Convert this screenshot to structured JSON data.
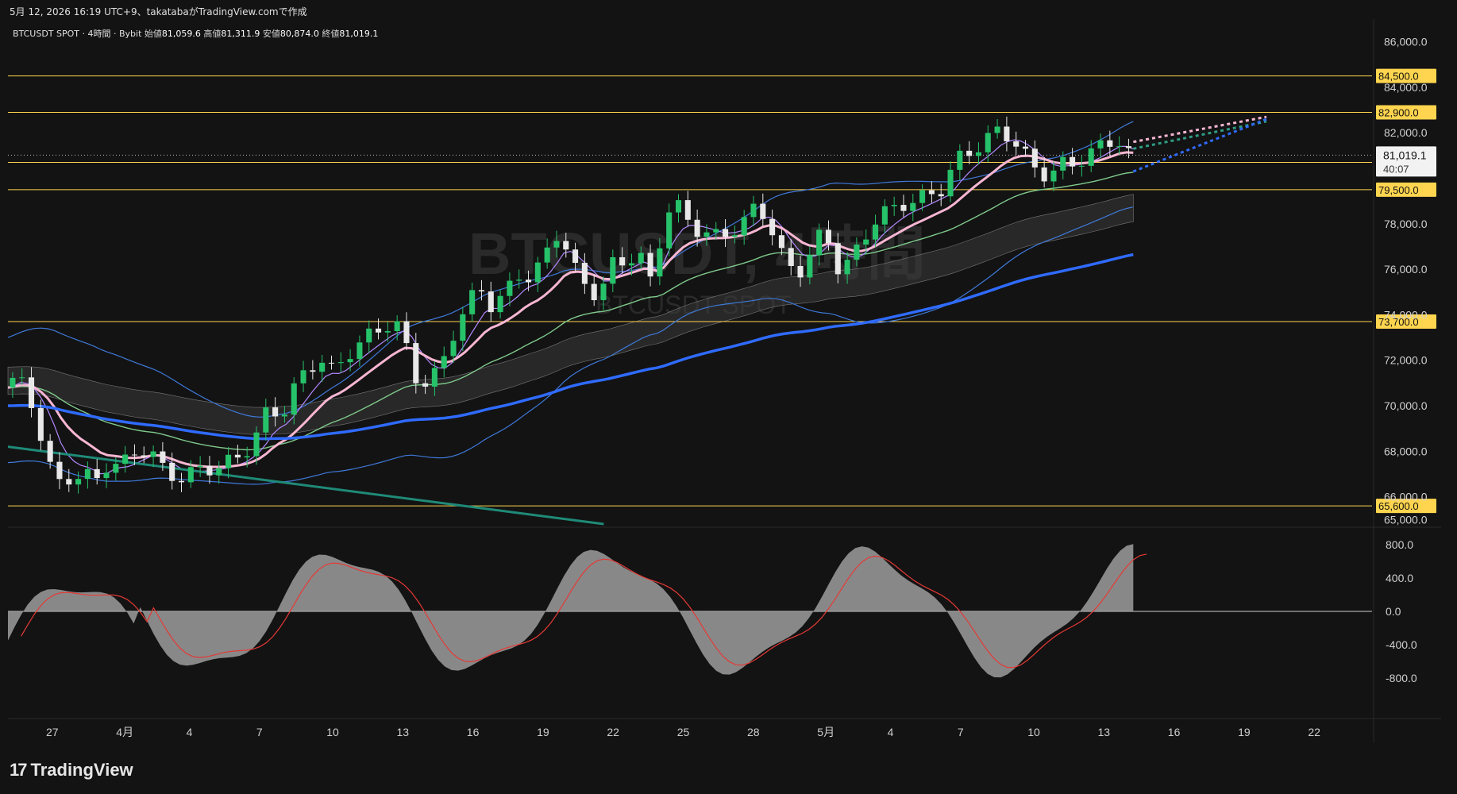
{
  "header": {
    "caption": "5月 12, 2026 16:19 UTC+9、takatabaがTradingView.comで作成"
  },
  "legend": {
    "symbol": "BTCUSDT SPOT · 4時間 · Bybit",
    "open_label": "始値",
    "open": "81,059.6",
    "high_label": "高値",
    "high": "81,311.9",
    "low_label": "安値",
    "low": "80,874.0",
    "close_label": "終値",
    "close": "81,019.1"
  },
  "watermark": {
    "line1": "BTCUSDT, 4時間",
    "line2": "BTCUSDT SPOT"
  },
  "price_axis": {
    "ticks": [
      "86,000.0",
      "84,000.0",
      "82,000.0",
      "78,000.0",
      "76,000.0",
      "74,000.0",
      "72,000.0",
      "70,000.0",
      "68,000.0",
      "66,000.0",
      "65,000.0"
    ],
    "current_price": "81,019.1",
    "countdown": "40:07"
  },
  "levels": [
    {
      "label": "84,500.0",
      "value": 84500
    },
    {
      "label": "82,900.0",
      "value": 82900
    },
    {
      "label": "80,700.0",
      "value": 80700
    },
    {
      "label": "79,500.0",
      "value": 79500
    },
    {
      "label": "73,700.0",
      "value": 73700
    },
    {
      "label": "65,600.0",
      "value": 65600
    }
  ],
  "osc_axis": {
    "ticks": [
      "800.0",
      "400.0",
      "0.0",
      "-400.0",
      "-800.0"
    ]
  },
  "time_axis": {
    "ticks": [
      "27",
      "4月",
      "4",
      "7",
      "10",
      "13",
      "16",
      "19",
      "22",
      "25",
      "28",
      "5月",
      "4",
      "7",
      "10",
      "13",
      "16",
      "19",
      "22"
    ]
  },
  "colors": {
    "bg": "#131313",
    "level": "#ffd54f",
    "up": "#26c26a",
    "down": "#e8e8e8",
    "ema_blue": "#2f6bff",
    "ema_pink": "#f7b6d2",
    "bb": "#3f79d9",
    "fast_line": "#b388ff",
    "mid_line": "#7fc98b",
    "osc_fill": "#9e9e9e",
    "osc_signal": "#e53935"
  },
  "branding": {
    "name": "TradingView"
  },
  "chart_data": {
    "type": "candlestick",
    "timeframe": "4時間",
    "ylim": [
      64800,
      87000
    ],
    "ohlc_last": {
      "open": 81059.6,
      "high": 81311.9,
      "low": 80874.0,
      "close": 81019.1
    },
    "close_path": [
      [
        0,
        70800
      ],
      [
        1,
        71400
      ],
      [
        2,
        70200
      ],
      [
        3,
        68500
      ],
      [
        4,
        66400
      ],
      [
        5,
        66800
      ],
      [
        6,
        67100
      ],
      [
        7,
        66600
      ],
      [
        8,
        67600
      ],
      [
        9,
        67400
      ],
      [
        10,
        67900
      ],
      [
        11,
        68200
      ],
      [
        12,
        67200
      ],
      [
        13,
        66800
      ],
      [
        14,
        67000
      ],
      [
        15,
        67200
      ],
      [
        16,
        67300
      ],
      [
        17,
        67500
      ],
      [
        18,
        67800
      ],
      [
        19,
        68600
      ],
      [
        20,
        69800
      ],
      [
        21,
        69600
      ],
      [
        22,
        70800
      ],
      [
        23,
        71600
      ],
      [
        24,
        72100
      ],
      [
        25,
        71400
      ],
      [
        26,
        72300
      ],
      [
        27,
        72800
      ],
      [
        28,
        73200
      ],
      [
        29,
        73600
      ],
      [
        30,
        73500
      ],
      [
        31,
        71300
      ],
      [
        32,
        71000
      ],
      [
        33,
        71600
      ],
      [
        34,
        73200
      ],
      [
        35,
        74400
      ],
      [
        36,
        75200
      ],
      [
        37,
        74300
      ],
      [
        38,
        75000
      ],
      [
        39,
        75800
      ],
      [
        40,
        75600
      ],
      [
        41,
        76700
      ],
      [
        42,
        77800
      ],
      [
        43,
        76100
      ],
      [
        44,
        75300
      ],
      [
        45,
        74800
      ],
      [
        46,
        76200
      ],
      [
        47,
        76400
      ],
      [
        48,
        76700
      ],
      [
        49,
        75300
      ],
      [
        50,
        78600
      ],
      [
        51,
        78700
      ],
      [
        52,
        77900
      ],
      [
        53,
        77600
      ],
      [
        54,
        77400
      ],
      [
        55,
        77700
      ],
      [
        56,
        78100
      ],
      [
        57,
        78900
      ],
      [
        58,
        77800
      ],
      [
        59,
        76300
      ],
      [
        60,
        75800
      ],
      [
        61,
        76700
      ],
      [
        62,
        77800
      ],
      [
        63,
        76100
      ],
      [
        64,
        76300
      ],
      [
        65,
        77400
      ],
      [
        66,
        78300
      ],
      [
        67,
        78600
      ],
      [
        68,
        78900
      ],
      [
        69,
        79000
      ],
      [
        70,
        79300
      ],
      [
        71,
        79600
      ],
      [
        72,
        80800
      ],
      [
        73,
        81200
      ],
      [
        74,
        81500
      ],
      [
        75,
        82100
      ],
      [
        76,
        81900
      ],
      [
        77,
        81100
      ],
      [
        78,
        80400
      ],
      [
        79,
        80100
      ],
      [
        80,
        80600
      ],
      [
        81,
        80700
      ],
      [
        82,
        81000
      ],
      [
        83,
        81500
      ],
      [
        84,
        81800
      ],
      [
        85,
        81000
      ]
    ],
    "series_x_span": [
      0,
      85
    ],
    "oscillator": {
      "ylim": [
        -1000,
        1000
      ],
      "ticks": [
        800,
        400,
        0,
        -400,
        -800
      ]
    }
  }
}
